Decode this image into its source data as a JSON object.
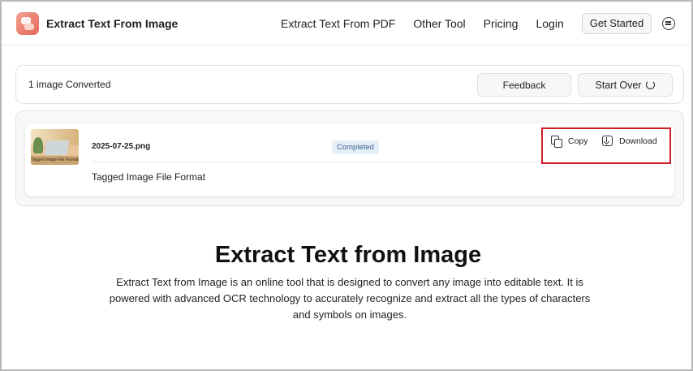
{
  "header": {
    "brand": "Extract Text From Image",
    "nav": [
      "Extract Text From PDF",
      "Other Tool",
      "Pricing",
      "Login"
    ],
    "get_started": "Get Started"
  },
  "status": {
    "text": "1  image Converted",
    "feedback": "Feedback",
    "start_over": "Start Over"
  },
  "result": {
    "thumbnail_caption": "Tagged Image File Format",
    "filename": "2025-07-25.png",
    "badge": "Completed",
    "copy": "Copy",
    "download": "Download",
    "extracted_text": "Tagged Image File Format"
  },
  "hero": {
    "title": "Extract Text from Image",
    "description": "Extract Text from Image is an online tool that is designed to convert any image into editable text. It is powered with advanced OCR technology to accurately recognize and extract all the types of characters and symbols on images."
  },
  "colors": {
    "highlight_border": "#cc1f26",
    "badge_bg": "#e5eff8",
    "badge_text": "#3b5f8a"
  }
}
